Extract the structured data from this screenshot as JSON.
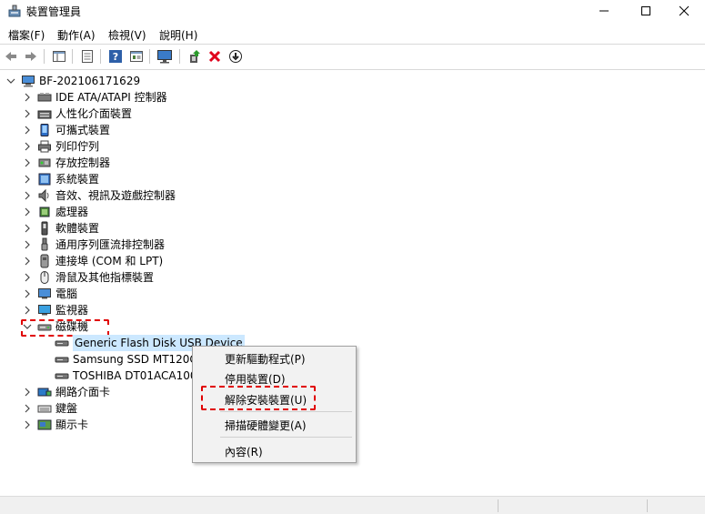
{
  "window": {
    "title": "裝置管理員",
    "minimize_glyph": "—",
    "maximize_glyph": "☐",
    "close_glyph": "✕"
  },
  "menu": {
    "file": "檔案(F)",
    "action": "動作(A)",
    "view": "檢視(V)",
    "help": "說明(H)"
  },
  "toolbar": {
    "icons": [
      "back-arrow-icon",
      "forward-arrow-icon",
      "show-hide-tree-icon",
      "properties-icon",
      "help-icon",
      "view-icon",
      "monitor-icon",
      "update-driver-icon",
      "uninstall-x-icon",
      "enable-down-arrow-icon"
    ],
    "uninstall_color": "#e0001b"
  },
  "tree": {
    "root": "BF-202106171629",
    "categories": [
      {
        "label": "IDE ATA/ATAPI 控制器",
        "icon": "ide-controller-icon"
      },
      {
        "label": "人性化介面裝置",
        "icon": "hid-icon"
      },
      {
        "label": "可攜式裝置",
        "icon": "portable-device-icon"
      },
      {
        "label": "列印佇列",
        "icon": "printer-icon"
      },
      {
        "label": "存放控制器",
        "icon": "storage-controller-icon"
      },
      {
        "label": "系統裝置",
        "icon": "system-device-icon"
      },
      {
        "label": "音效、視訊及遊戲控制器",
        "icon": "sound-icon"
      },
      {
        "label": "處理器",
        "icon": "processor-icon"
      },
      {
        "label": "軟體裝置",
        "icon": "software-device-icon"
      },
      {
        "label": "通用序列匯流排控制器",
        "icon": "usb-icon"
      },
      {
        "label": "連接埠 (COM 和 LPT)",
        "icon": "port-icon"
      },
      {
        "label": "滑鼠及其他指標裝置",
        "icon": "mouse-icon"
      },
      {
        "label": "電腦",
        "icon": "computer-icon"
      },
      {
        "label": "監視器",
        "icon": "monitor-icon"
      }
    ],
    "expanded": {
      "label": "磁碟機",
      "icon": "disk-drive-icon",
      "children": [
        {
          "label": "Generic Flash Disk USB Device",
          "selected": true
        },
        {
          "label": "Samsung SSD MT120G"
        },
        {
          "label": "TOSHIBA DT01ACA100"
        }
      ]
    },
    "after": [
      {
        "label": "網路介面卡",
        "icon": "network-adapter-icon"
      },
      {
        "label": "鍵盤",
        "icon": "keyboard-icon"
      },
      {
        "label": "顯示卡",
        "icon": "display-adapter-icon"
      }
    ]
  },
  "context_menu": {
    "update_driver": "更新驅動程式(P)",
    "disable_device": "停用裝置(D)",
    "uninstall_device": "解除安裝裝置(U)",
    "scan_hardware": "掃描硬體變更(A)",
    "properties": "內容(R)"
  },
  "highlight_color": "#e00000",
  "selection_color": "#cce8ff"
}
